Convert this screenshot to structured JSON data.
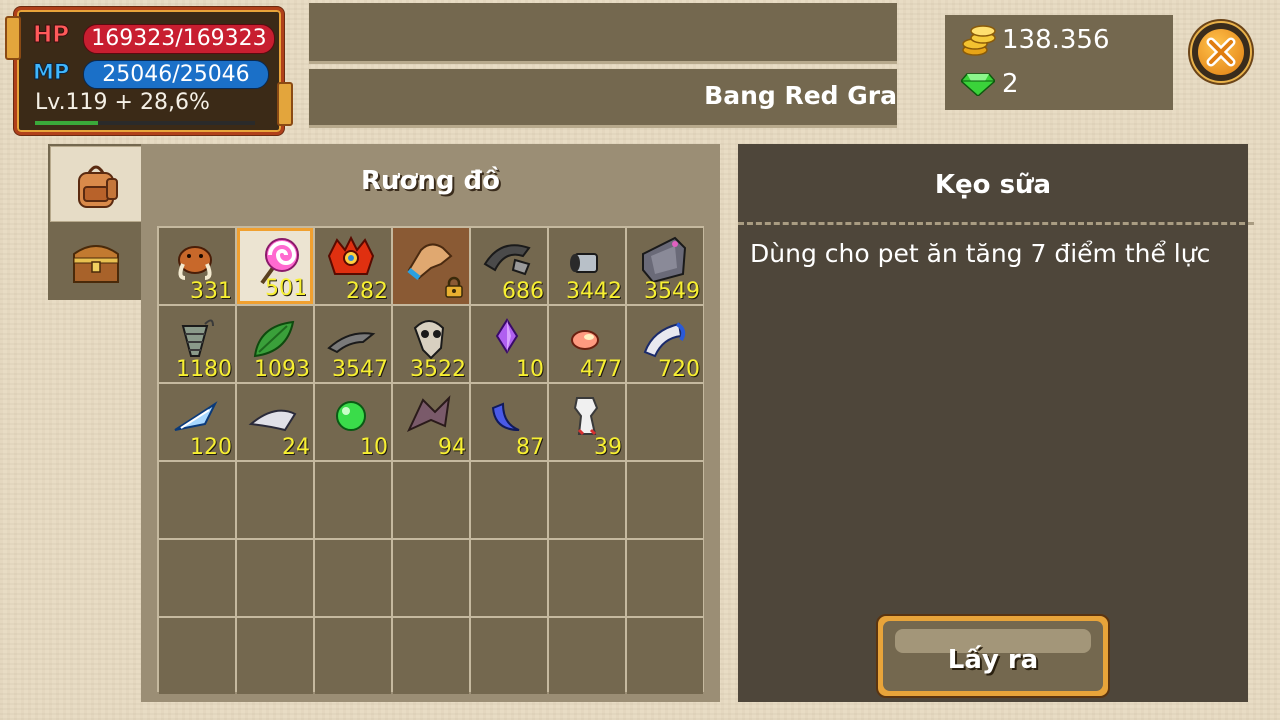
{
  "status": {
    "hp_label": "HP",
    "hp_value": "169323/169323",
    "mp_label": "MP",
    "mp_value": "25046/25046",
    "level": "Lv.119 + 28,6%",
    "level_progress": 0.286
  },
  "header": {
    "guild_name": "Bang Red Gra"
  },
  "currency": {
    "gold": "138.356",
    "gems": "2"
  },
  "inventory": {
    "title": "Rương đồ",
    "tabs": [
      {
        "icon": "backpack-icon",
        "active": true
      },
      {
        "icon": "treasure-chest-icon",
        "active": false
      }
    ],
    "items": [
      {
        "icon": "mammoth-icon",
        "qty": "331"
      },
      {
        "icon": "lollipop-icon",
        "qty": "501",
        "selected": true
      },
      {
        "icon": "dragon-head-icon",
        "qty": "282"
      },
      {
        "icon": "gauntlet-icon",
        "qty": "",
        "locked": true
      },
      {
        "icon": "claw-hook-icon",
        "qty": "686"
      },
      {
        "icon": "metal-cylinder-icon",
        "qty": "3442"
      },
      {
        "icon": "stone-shield-icon",
        "qty": "3549"
      },
      {
        "icon": "drill-shell-icon",
        "qty": "1180"
      },
      {
        "icon": "green-leaf-icon",
        "qty": "1093"
      },
      {
        "icon": "grey-claw-icon",
        "qty": "3547"
      },
      {
        "icon": "skull-icon",
        "qty": "3522"
      },
      {
        "icon": "purple-crystal-icon",
        "qty": "10"
      },
      {
        "icon": "pink-shell-icon",
        "qty": "477"
      },
      {
        "icon": "blue-horn-icon",
        "qty": "720"
      },
      {
        "icon": "ice-blade-icon",
        "qty": "120"
      },
      {
        "icon": "silver-fang-icon",
        "qty": "24"
      },
      {
        "icon": "green-orb-icon",
        "qty": "10"
      },
      {
        "icon": "bat-wing-icon",
        "qty": "94"
      },
      {
        "icon": "blue-crescent-icon",
        "qty": "87"
      },
      {
        "icon": "white-cloth-icon",
        "qty": "39"
      }
    ],
    "total_slots": 42
  },
  "detail": {
    "title": "Kẹo sữa",
    "description": "Dùng cho pet ăn tăng 7 điểm thể lực",
    "take_button": "Lấy ra"
  },
  "colors": {
    "panel": "#74684f",
    "panel_dark": "#4e463a",
    "qty_yellow": "#f8f032",
    "selected_border": "#f0a030",
    "hp_red": "#c81e30",
    "mp_blue": "#1b70c8"
  }
}
